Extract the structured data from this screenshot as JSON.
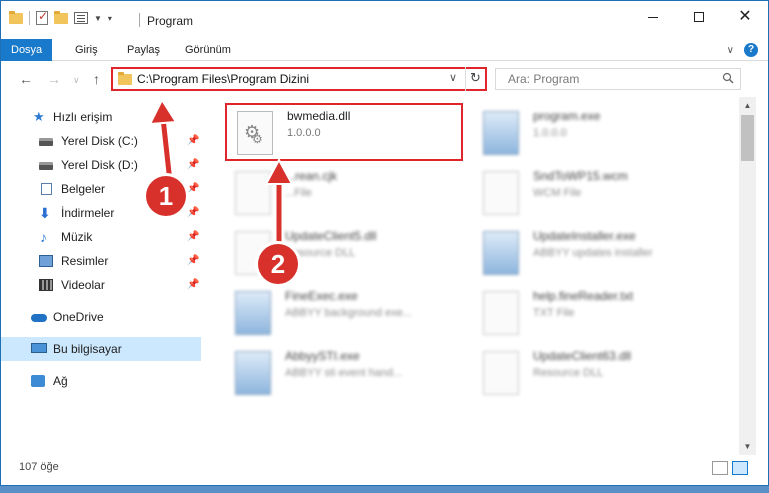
{
  "window": {
    "title": "Program"
  },
  "ribbon": {
    "tabs": [
      {
        "label": "Dosya"
      },
      {
        "label": "Giriş"
      },
      {
        "label": "Paylaş"
      },
      {
        "label": "Görünüm"
      }
    ],
    "help": "?"
  },
  "nav": {
    "address": "C:\\Program Files\\Program Dizini",
    "search_placeholder": "Ara: Program"
  },
  "sidebar": {
    "items": [
      {
        "label": "Hızlı erişim",
        "icon": "star-icon"
      },
      {
        "label": "Yerel Disk (C:)",
        "icon": "disk-icon"
      },
      {
        "label": "Yerel Disk (D:)",
        "icon": "disk-icon"
      },
      {
        "label": "Belgeler",
        "icon": "documents-icon"
      },
      {
        "label": "İndirmeler",
        "icon": "download-icon"
      },
      {
        "label": "Müzik",
        "icon": "music-icon"
      },
      {
        "label": "Resimler",
        "icon": "pictures-icon"
      },
      {
        "label": "Videolar",
        "icon": "videos-icon"
      },
      {
        "label": "OneDrive",
        "icon": "cloud-icon"
      },
      {
        "label": "Bu bilgisayar",
        "icon": "computer-icon"
      },
      {
        "label": "Ağ",
        "icon": "network-icon"
      }
    ]
  },
  "files": [
    {
      "name": "bwmedia.dll",
      "sub": "1.0.0.0"
    },
    {
      "name": "program.exe",
      "sub": "1.0.0.0"
    },
    {
      "name": "...rean.cjk",
      "sub": "...File"
    },
    {
      "name": "SndToWP15.wcm",
      "sub": "WCM File"
    },
    {
      "name": "UpdateClient5.dll",
      "sub": "Resource DLL"
    },
    {
      "name": "UpdateInstaller.exe",
      "sub": "ABBYY updates installer"
    },
    {
      "name": "FineExec.exe",
      "sub": "ABBYY background exe..."
    },
    {
      "name": "help.fineReader.txt",
      "sub": "TXT File"
    },
    {
      "name": "AbbyySTI.exe",
      "sub": "ABBYY sti event hand..."
    },
    {
      "name": "UpdateClient63.dll",
      "sub": "Resource DLL"
    }
  ],
  "status": {
    "count": "107 öğe"
  },
  "callouts": {
    "one": "1",
    "two": "2"
  },
  "colors": {
    "accent": "#1979ca",
    "highlight": "#e0262a",
    "callout": "#d8302b"
  }
}
